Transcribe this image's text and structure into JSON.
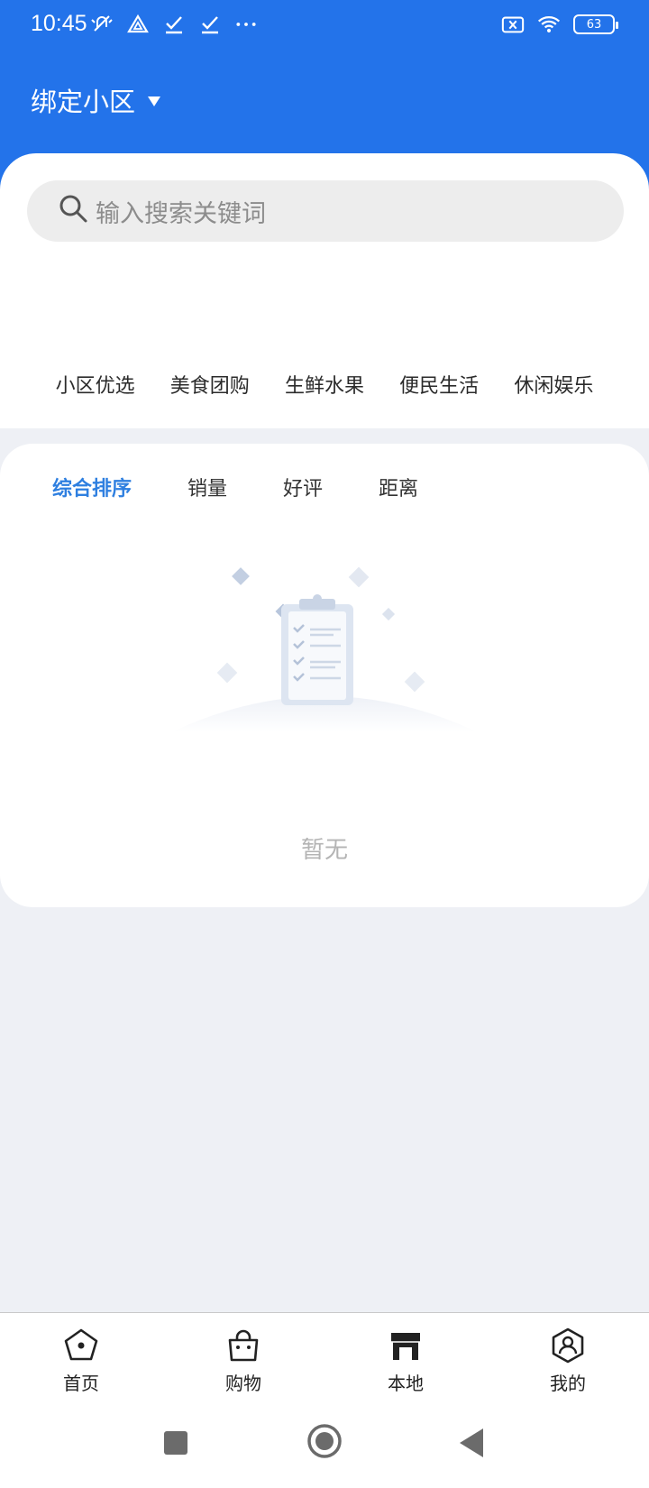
{
  "status_bar": {
    "time": "10:45",
    "battery_level": "63",
    "icons_left": [
      "silent-icon",
      "drive-icon",
      "check-icon",
      "check-icon",
      "more-icon"
    ],
    "icons_right": [
      "sim-off-icon",
      "wifi-icon",
      "battery-icon"
    ]
  },
  "header": {
    "community_label": "绑定小区",
    "background_color": "#2373ea"
  },
  "search": {
    "placeholder": "输入搜索关键词"
  },
  "categories": [
    "小区优选",
    "美食团购",
    "生鲜水果",
    "便民生活",
    "休闲娱乐"
  ],
  "sort_tabs": [
    {
      "label": "综合排序",
      "active": true
    },
    {
      "label": "销量",
      "active": false
    },
    {
      "label": "好评",
      "active": false
    },
    {
      "label": "距离",
      "active": false
    }
  ],
  "empty_state": {
    "text": "暂无",
    "icon": "clipboard-empty-icon"
  },
  "bottom_nav": [
    {
      "label": "首页",
      "icon": "home-pentagon-icon"
    },
    {
      "label": "购物",
      "icon": "shopping-bag-icon"
    },
    {
      "label": "本地",
      "icon": "store-icon"
    },
    {
      "label": "我的",
      "icon": "user-profile-icon"
    }
  ],
  "colors": {
    "accent": "#2e7fe0",
    "page_bg": "#eef0f5"
  }
}
